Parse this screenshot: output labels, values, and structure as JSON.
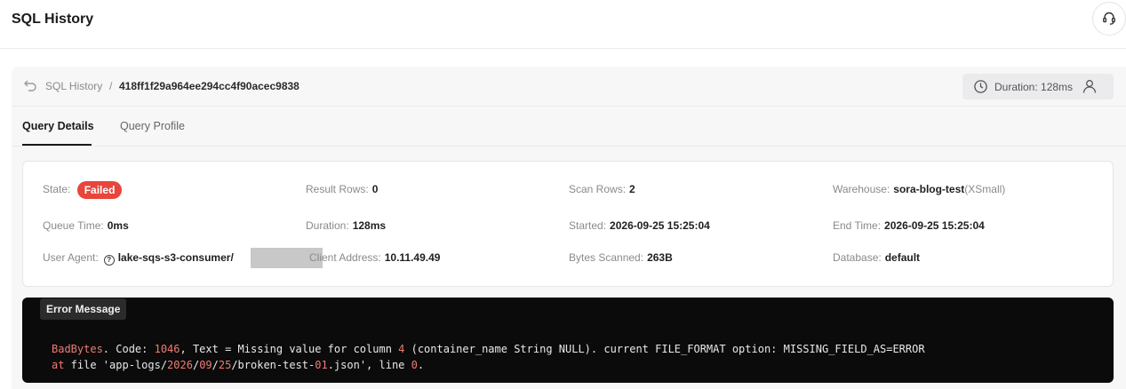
{
  "header": {
    "title": "SQL History",
    "support_icon": "headset-icon"
  },
  "breadcrumb": {
    "root": "SQL History",
    "separator": "/",
    "query_id": "418ff1f29a964ee294cc4f90acec9838"
  },
  "duration_pill": {
    "label": "Duration: 128ms"
  },
  "tabs": [
    {
      "label": "Query Details",
      "active": true
    },
    {
      "label": "Query Profile",
      "active": false
    }
  ],
  "details": {
    "state": {
      "label": "State",
      "value": "Failed",
      "color": "#e8453c"
    },
    "result_rows": {
      "label": "Result Rows",
      "value": "0"
    },
    "scan_rows": {
      "label": "Scan Rows",
      "value": "2"
    },
    "warehouse": {
      "label": "Warehouse",
      "value": "sora-blog-test",
      "size": "(XSmall)"
    },
    "queue_time": {
      "label": "Queue Time",
      "value": "0ms"
    },
    "duration": {
      "label": "Duration",
      "value": "128ms"
    },
    "started": {
      "label": "Started",
      "value": "2026-09-25 15:25:04"
    },
    "end_time": {
      "label": "End Time",
      "value": "2026-09-25 15:25:04"
    },
    "user_agent": {
      "label": "User Agent",
      "value": "lake-sqs-s3-consumer/"
    },
    "client_address": {
      "label": "Client Address",
      "value": "10.11.49.49"
    },
    "bytes_scanned": {
      "label": "Bytes Scanned",
      "value": "263B"
    },
    "database": {
      "label": "Database",
      "value": "default"
    }
  },
  "error": {
    "title": "Error Message",
    "line1": {
      "kind": "BadBytes",
      "code_prefix": ". Code: ",
      "code": "1046",
      "mid": ", Text = Missing value for column ",
      "column": "4",
      "rest": " (container_name String NULL). current FILE_FORMAT option: MISSING_FIELD_AS=ERROR"
    },
    "line2": {
      "at": "at",
      "pre": " file 'app-logs/",
      "year": "2026",
      "s1": "/",
      "month": "09",
      "s2": "/",
      "day": "25",
      "name": "/broken-test-",
      "num": "01",
      "ext": ".json', line ",
      "line": "0",
      "end": "."
    },
    "highlight_color": "#ef7b73",
    "background": "#0b0b0b"
  }
}
